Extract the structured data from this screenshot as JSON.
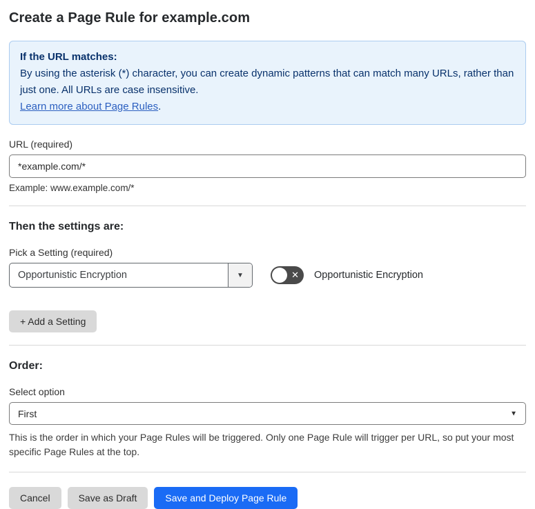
{
  "page": {
    "title": "Create a Page Rule for example.com"
  },
  "info_box": {
    "heading": "If the URL matches:",
    "body": "By using the asterisk (*) character, you can create dynamic patterns that can match many URLs, rather than just one. All URLs are case insensitive.",
    "link_label": "Learn more about Page Rules",
    "link_suffix": "."
  },
  "url_field": {
    "label": "URL (required)",
    "value": "*example.com/*",
    "helper": "Example: www.example.com/*"
  },
  "settings_section": {
    "heading": "Then the settings are:",
    "setting_label": "Pick a Setting (required)",
    "setting_value": "Opportunistic Encryption",
    "toggle_state": "off",
    "toggle_label": "Opportunistic Encryption",
    "add_setting_label": "+ Add a Setting"
  },
  "order_section": {
    "heading": "Order:",
    "select_label": "Select option",
    "select_value": "First",
    "description": "This is the order in which your Page Rules will be triggered. Only one Page Rule will trigger per URL, so put your most specific Page Rules at the top."
  },
  "footer": {
    "cancel_label": "Cancel",
    "save_draft_label": "Save as Draft",
    "save_deploy_label": "Save and Deploy Page Rule"
  },
  "icons": {
    "dropdown_arrow": "▼",
    "select_chevron": "▼",
    "toggle_off_x": "✕"
  },
  "colors": {
    "primary_button": "#1a6bf5",
    "secondary_button": "#d9d9d9",
    "info_background": "#e9f3fc",
    "info_border": "#abccf0",
    "info_text": "#08316b",
    "link": "#2b5fc0",
    "toggle_off_background": "#4a4a4a"
  }
}
